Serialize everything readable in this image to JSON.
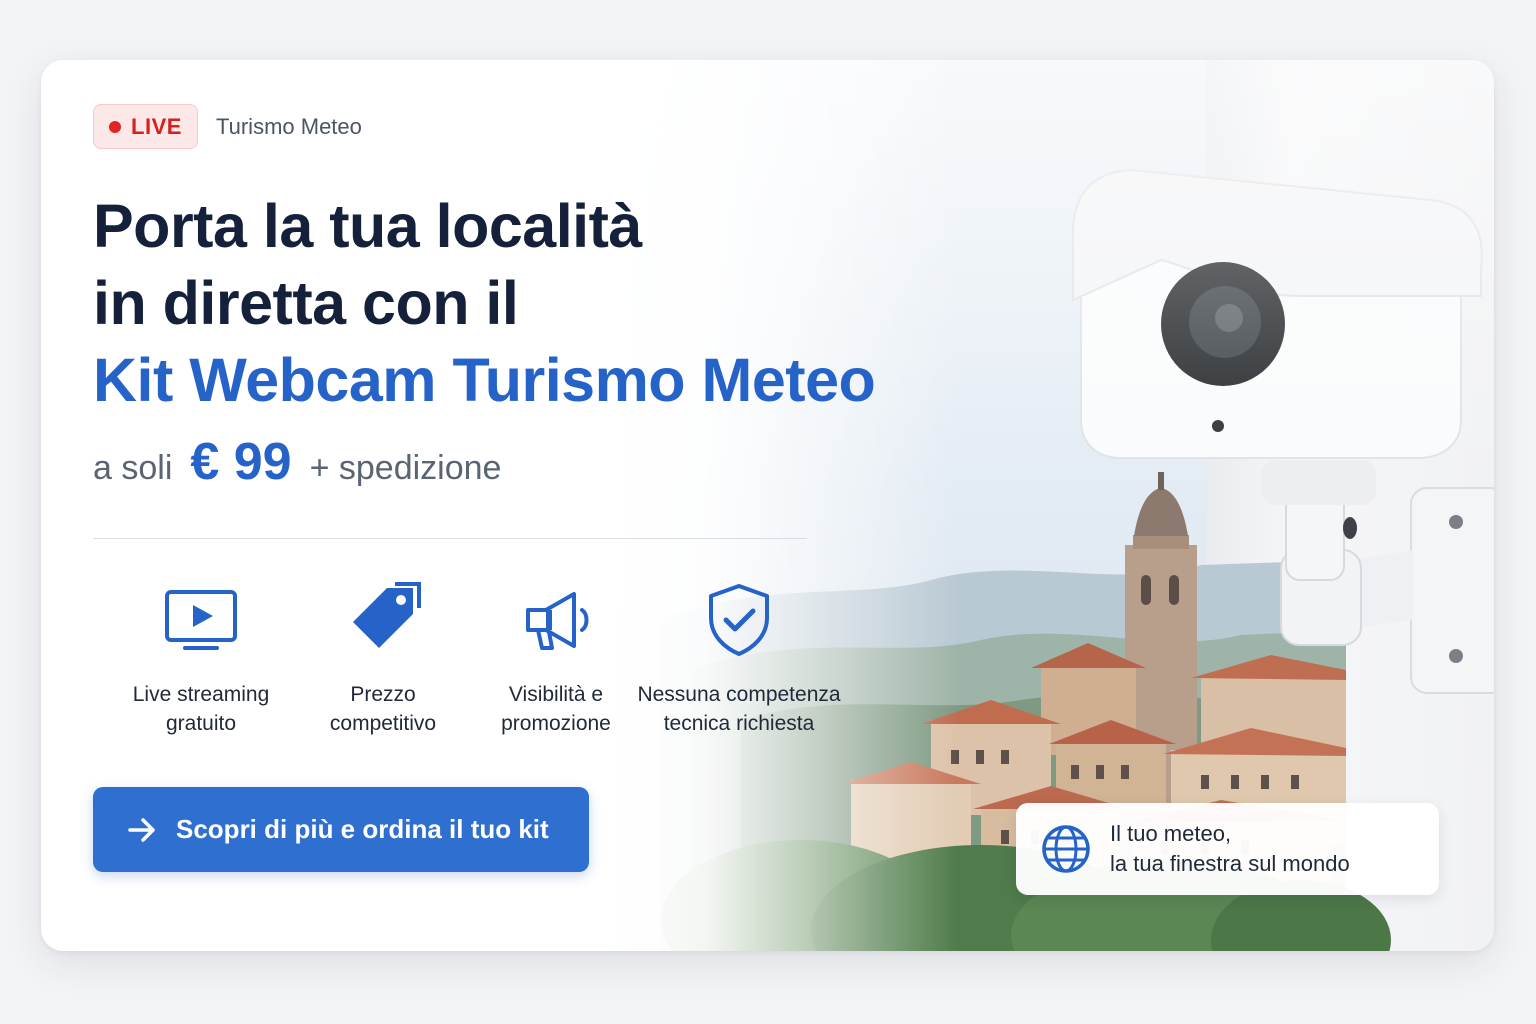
{
  "badge": {
    "live_label": "LIVE"
  },
  "brand": "Turismo Meteo",
  "headline": {
    "line1": "Porta la tua località",
    "line2": "in diretta con il",
    "line3_accent": "Kit Webcam Turismo Meteo"
  },
  "pricing": {
    "prefix": "a soli",
    "price": "€ 99",
    "suffix": "+ spedizione"
  },
  "features": [
    {
      "icon": "tv-play-icon",
      "line1": "Live streaming",
      "line2": "gratuito"
    },
    {
      "icon": "price-tag-icon",
      "line1": "Prezzo",
      "line2": "competitivo"
    },
    {
      "icon": "megaphone-icon",
      "line1": "Visibilità e",
      "line2": "promozione"
    },
    {
      "icon": "shield-check-icon",
      "line1": "Nessuna competenza",
      "line2": "tecnica richiesta"
    }
  ],
  "cta": {
    "label": "Scopri di più e ordina il tuo kit",
    "icon": "arrow-right-icon"
  },
  "tagline": {
    "icon": "globe-icon",
    "line1": "Il tuo meteo,",
    "line2": "la tua finestra sul mondo"
  },
  "colors": {
    "accent": "#2563c9",
    "cta": "#2f6fd0",
    "live_red": "#e02424",
    "live_bg": "#fde8e8",
    "heading": "#15213a"
  }
}
